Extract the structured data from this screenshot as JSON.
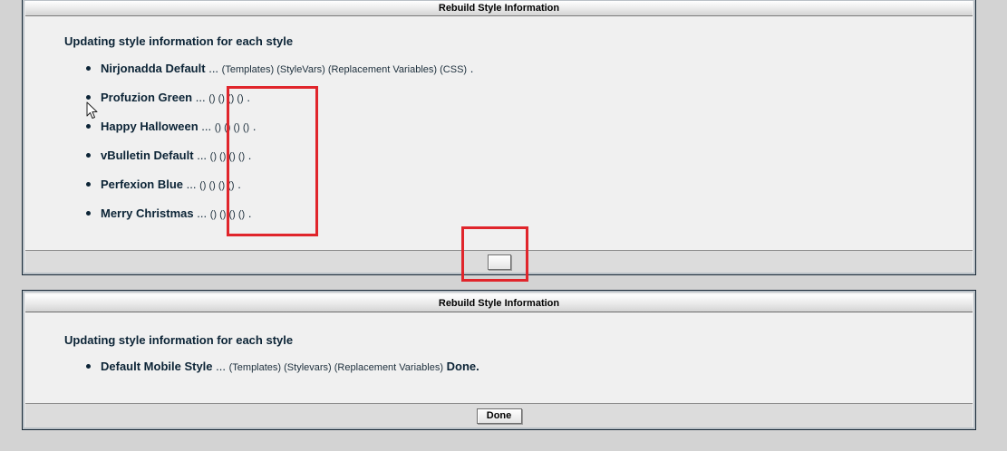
{
  "panel1": {
    "header": "Rebuild Style Information",
    "title": "Updating style information for each style",
    "rows": [
      {
        "name": "Nirjonadda Default",
        "dots": "...",
        "steps": "(Templates) (StyleVars) (Replacement Variables) (CSS)",
        "end": "."
      },
      {
        "name": "Profuzion Green",
        "dots": "...",
        "steps": "() () () ()",
        "end": "."
      },
      {
        "name": "Happy Halloween",
        "dots": "...",
        "steps": "() () () ()",
        "end": "."
      },
      {
        "name": "vBulletin Default",
        "dots": "...",
        "steps": "() () () ()",
        "end": "."
      },
      {
        "name": "Perfexion Blue",
        "dots": "...",
        "steps": "() () () ()",
        "end": "."
      },
      {
        "name": "Merry Christmas",
        "dots": "...",
        "steps": "() () () ()",
        "end": "."
      }
    ],
    "footer_button_label": ""
  },
  "panel2": {
    "header": "Rebuild Style Information",
    "title": "Updating style information for each style",
    "rows": [
      {
        "name": "Default Mobile Style",
        "dots": "...",
        "steps": "(Templates) (Stylevars) (Replacement Variables)",
        "end": "Done."
      }
    ],
    "footer_button_label": "Done"
  },
  "colors": {
    "page_background": "#d3d3d3",
    "panel_background": "#f0f0f0",
    "text": "#0c2436",
    "highlight": "#e0252b"
  },
  "icons": [
    "mouse-pointer-icon"
  ]
}
